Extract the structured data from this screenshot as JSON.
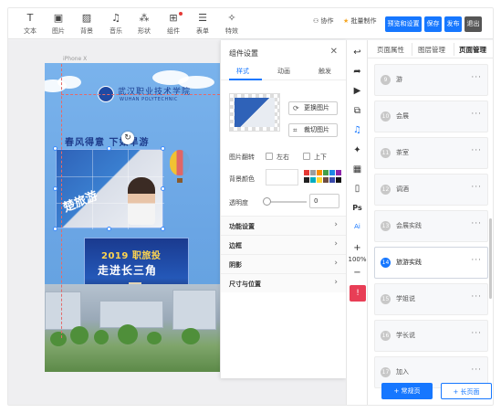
{
  "toolbar": {
    "tools": [
      {
        "icon": "text-icon",
        "glyph": "T",
        "label": "文本"
      },
      {
        "icon": "image-icon",
        "glyph": "▣",
        "label": "图片"
      },
      {
        "icon": "background-icon",
        "glyph": "▨",
        "label": "背景"
      },
      {
        "icon": "music-icon",
        "glyph": "♫",
        "label": "音乐"
      },
      {
        "icon": "shape-icon",
        "glyph": "⁂",
        "label": "形状"
      },
      {
        "icon": "component-icon",
        "glyph": "⊞",
        "label": "组件"
      },
      {
        "icon": "form-icon",
        "glyph": "☰",
        "label": "表单"
      },
      {
        "icon": "effects-icon",
        "glyph": "✧",
        "label": "特效"
      }
    ],
    "collab": "协作",
    "batch": "批量制作",
    "preview_btn": "预览和设置",
    "save_btn": "保存",
    "publish_btn": "发布",
    "exit_btn": "退出",
    "colors": {
      "primary": "#1677ff",
      "exit": "#555555"
    }
  },
  "canvas": {
    "device_label": "iPhone X",
    "logo_cn": "武汉职业技术学院",
    "logo_en": "WUHAN POLYTECHNIC",
    "slogan": "春风得意  下如旱游",
    "flag_text": "楚旅游",
    "stage_line1": "2019 职旅投",
    "stage_line2": "走进长三角"
  },
  "panel": {
    "title": "组件设置",
    "tabs": [
      "样式",
      "动画",
      "触发"
    ],
    "replace_image": "更换图片",
    "crop_image": "裁切图片",
    "flip_label": "图片翻转",
    "flip_lr": "左右",
    "flip_ud": "上下",
    "bg_color_label": "背景颜色",
    "swatches": [
      "#e53935",
      "#9e9e9e",
      "#fb8c00",
      "#43a047",
      "#1e88e5",
      "#8e24aa",
      "#212121",
      "#00acc1",
      "#fdd835",
      "#6d4c41",
      "#3949ab",
      "#111111"
    ],
    "opacity_label": "透明度",
    "opacity_value": "0",
    "sections": [
      "功能设置",
      "边框",
      "阴影",
      "尺寸与位置"
    ]
  },
  "vbar": {
    "icons": [
      {
        "name": "back-icon",
        "glyph": "↩"
      },
      {
        "name": "redo-icon",
        "glyph": "➦"
      },
      {
        "name": "play-icon",
        "glyph": "▶"
      },
      {
        "name": "copy-icon",
        "glyph": "⧉"
      },
      {
        "name": "music-note-icon",
        "glyph": "♫"
      },
      {
        "name": "sparkle-icon",
        "glyph": "✦"
      },
      {
        "name": "grid-icon",
        "glyph": "▦"
      },
      {
        "name": "phone-icon",
        "glyph": "▯"
      },
      {
        "name": "ps-icon",
        "glyph": "Ps"
      },
      {
        "name": "ai-icon",
        "glyph": "Ai"
      },
      {
        "name": "zoom-in-icon",
        "glyph": "+"
      }
    ],
    "zoom": "100%",
    "zoom_out": "−",
    "alert_glyph": "!"
  },
  "right": {
    "tabs": [
      "页面属性",
      "图层管理",
      "页面管理"
    ],
    "pages": [
      {
        "num": "9",
        "name": "游",
        "active": false
      },
      {
        "num": "10",
        "name": "会展",
        "active": false
      },
      {
        "num": "11",
        "name": "茶室",
        "active": false
      },
      {
        "num": "12",
        "name": "调酒",
        "active": false
      },
      {
        "num": "13",
        "name": "会展实践",
        "active": false
      },
      {
        "num": "14",
        "name": "旅游实践",
        "active": true
      },
      {
        "num": "15",
        "name": "学姐说",
        "active": false
      },
      {
        "num": "16",
        "name": "学长说",
        "active": false
      },
      {
        "num": "17",
        "name": "加入",
        "active": false
      }
    ],
    "more": "···",
    "add_normal": "+ 常规页",
    "add_long": "+ 长页面"
  }
}
